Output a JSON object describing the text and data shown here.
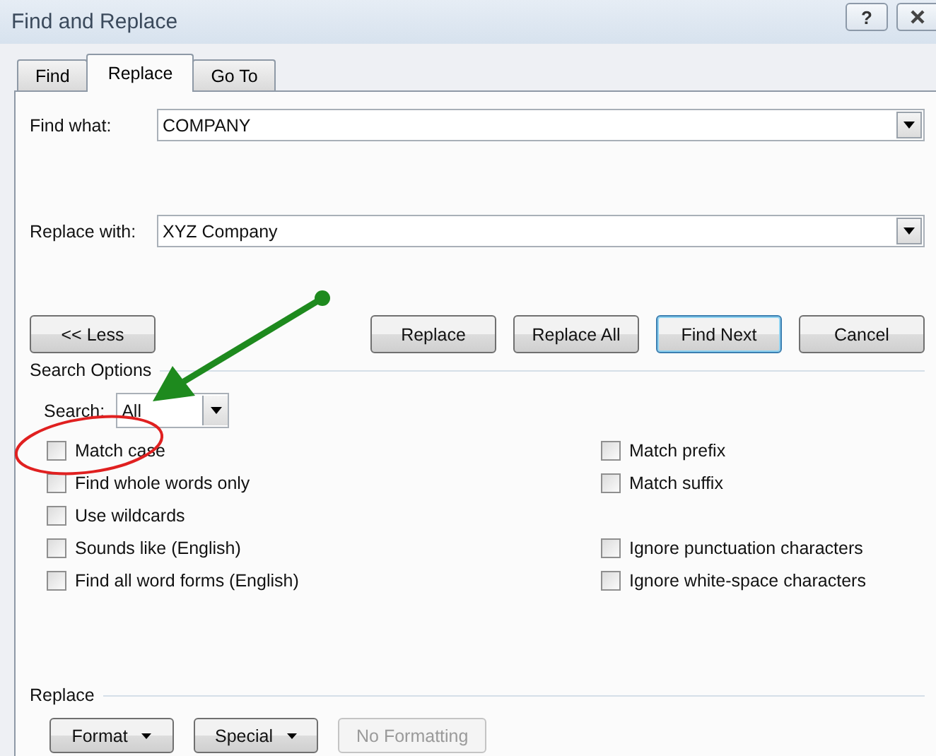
{
  "window": {
    "title": "Find and Replace",
    "controls": [
      {
        "kind": "help",
        "label": "?"
      },
      {
        "kind": "close"
      }
    ]
  },
  "tabs": [
    {
      "label": "Find",
      "selected": false
    },
    {
      "label": "Replace",
      "selected": true
    },
    {
      "label": "Go To",
      "selected": false
    }
  ],
  "fields": [
    {
      "label": "Find what:",
      "value": "COMPANY"
    },
    {
      "label": "Replace with:",
      "value": "XYZ Company"
    }
  ],
  "less_button": "<< Less",
  "actions": [
    {
      "label": "Replace",
      "default": false
    },
    {
      "label": "Replace All",
      "default": false
    },
    {
      "label": "Find Next",
      "default": true
    },
    {
      "label": "Cancel",
      "default": false
    }
  ],
  "search_options": {
    "heading": "Search Options",
    "search_label": "Search:",
    "search_value": "All",
    "rows": [
      {
        "left": {
          "label": "Match case",
          "checked": false
        },
        "right": {
          "label": "Match prefix",
          "checked": false
        }
      },
      {
        "left": {
          "label": "Find whole words only",
          "checked": false
        },
        "right": {
          "label": "Match suffix",
          "checked": false
        }
      },
      {
        "left": {
          "label": "Use wildcards",
          "checked": false
        }
      },
      {
        "left": {
          "label": "Sounds like (English)",
          "checked": false
        },
        "right": {
          "label": "Ignore punctuation characters",
          "checked": false
        }
      },
      {
        "left": {
          "label": "Find all word forms (English)",
          "checked": false
        },
        "right": {
          "label": "Ignore white-space characters",
          "checked": false
        }
      }
    ]
  },
  "replace_section": {
    "heading": "Replace",
    "buttons": [
      {
        "label": "Format",
        "disabled": false,
        "menu": true
      },
      {
        "label": "Special",
        "disabled": false,
        "menu": true
      },
      {
        "label": "No Formatting",
        "disabled": true,
        "menu": false
      }
    ]
  },
  "annotations": [
    {
      "kind": "arrow",
      "color": "#1e8a1e"
    },
    {
      "kind": "ellipse",
      "color": "#e02020"
    }
  ]
}
